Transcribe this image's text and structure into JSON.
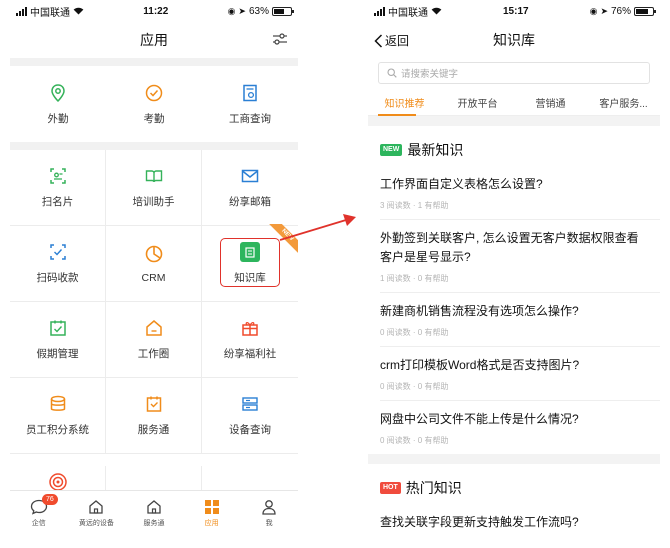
{
  "left": {
    "status": {
      "carrier": "中国联通",
      "time": "11:22",
      "battery": "63%",
      "battery_level": 0.63
    },
    "title": "应用",
    "filter_icon": "sliders-icon",
    "top_apps": [
      {
        "label": "外勤",
        "icon": "location-pin-icon",
        "color": "#35b25a"
      },
      {
        "label": "考勤",
        "icon": "check-circle-icon",
        "color": "#f08c1a"
      },
      {
        "label": "工商查询",
        "icon": "document-search-icon",
        "color": "#2a7fd4"
      }
    ],
    "apps": [
      {
        "label": "扫名片",
        "icon": "scan-card-icon",
        "color": "#35b25a"
      },
      {
        "label": "培训助手",
        "icon": "book-icon",
        "color": "#35b25a"
      },
      {
        "label": "纷享邮箱",
        "icon": "mail-icon",
        "color": "#2a7fd4"
      },
      {
        "label": "扫码收款",
        "icon": "scan-qr-icon",
        "color": "#2a7fd4"
      },
      {
        "label": "CRM",
        "icon": "pie-chart-icon",
        "color": "#f08c1a"
      },
      {
        "label": "知识库",
        "icon": "knowledge-icon",
        "color": "#2db55d",
        "badge": "NEW"
      },
      {
        "label": "假期管理",
        "icon": "calendar-check-icon",
        "color": "#35b25a"
      },
      {
        "label": "工作圈",
        "icon": "house-icon",
        "color": "#f08c1a"
      },
      {
        "label": "纷享福利社",
        "icon": "gift-icon",
        "color": "#f04b2d"
      },
      {
        "label": "员工积分系统",
        "icon": "database-icon",
        "color": "#f08c1a"
      },
      {
        "label": "服务通",
        "icon": "service-icon",
        "color": "#f08c1a"
      },
      {
        "label": "设备查询",
        "icon": "device-icon",
        "color": "#2a7fd4"
      }
    ],
    "tabbar": [
      {
        "label": "企信",
        "icon": "chat-bubble-icon",
        "badge": "76"
      },
      {
        "label": "黄远的设备",
        "icon": "house-outline-icon"
      },
      {
        "label": "服务通",
        "icon": "house-outline-icon"
      },
      {
        "label": "应用",
        "icon": "app-grid-icon",
        "active": true
      },
      {
        "label": "我",
        "icon": "person-icon"
      }
    ]
  },
  "right": {
    "status": {
      "carrier": "中国联通",
      "time": "15:17",
      "battery": "76%",
      "battery_level": 0.76
    },
    "back_label": "返回",
    "title": "知识库",
    "search_placeholder": "请搜索关键字",
    "tabs": [
      "知识推荐",
      "开放平台",
      "营销通",
      "客户服务..."
    ],
    "section_latest": {
      "tag": "NEW",
      "title": "最新知识"
    },
    "latest": [
      {
        "q": "工作界面自定义表格怎么设置?",
        "meta": "3 阅读数 · 1 有帮助"
      },
      {
        "q": "外勤签到关联客户, 怎么设置无客户数据权限查看客户是星号显示?",
        "meta": "1 阅读数 · 0 有帮助"
      },
      {
        "q": "新建商机销售流程没有选项怎么操作?",
        "meta": "0 阅读数 · 0 有帮助"
      },
      {
        "q": "crm打印模板Word格式是否支持图片?",
        "meta": "0 阅读数 · 0 有帮助"
      },
      {
        "q": "网盘中公司文件不能上传是什么情况?",
        "meta": "0 阅读数 · 0 有帮助"
      }
    ],
    "section_hot": {
      "tag": "HOT",
      "title": "热门知识"
    },
    "hot": [
      {
        "q": "查找关联字段更新支持触发工作流吗?"
      }
    ]
  },
  "colors": {
    "accent": "#f08c1a",
    "highlight": "#e0322b",
    "arrow": "#e0322b"
  }
}
